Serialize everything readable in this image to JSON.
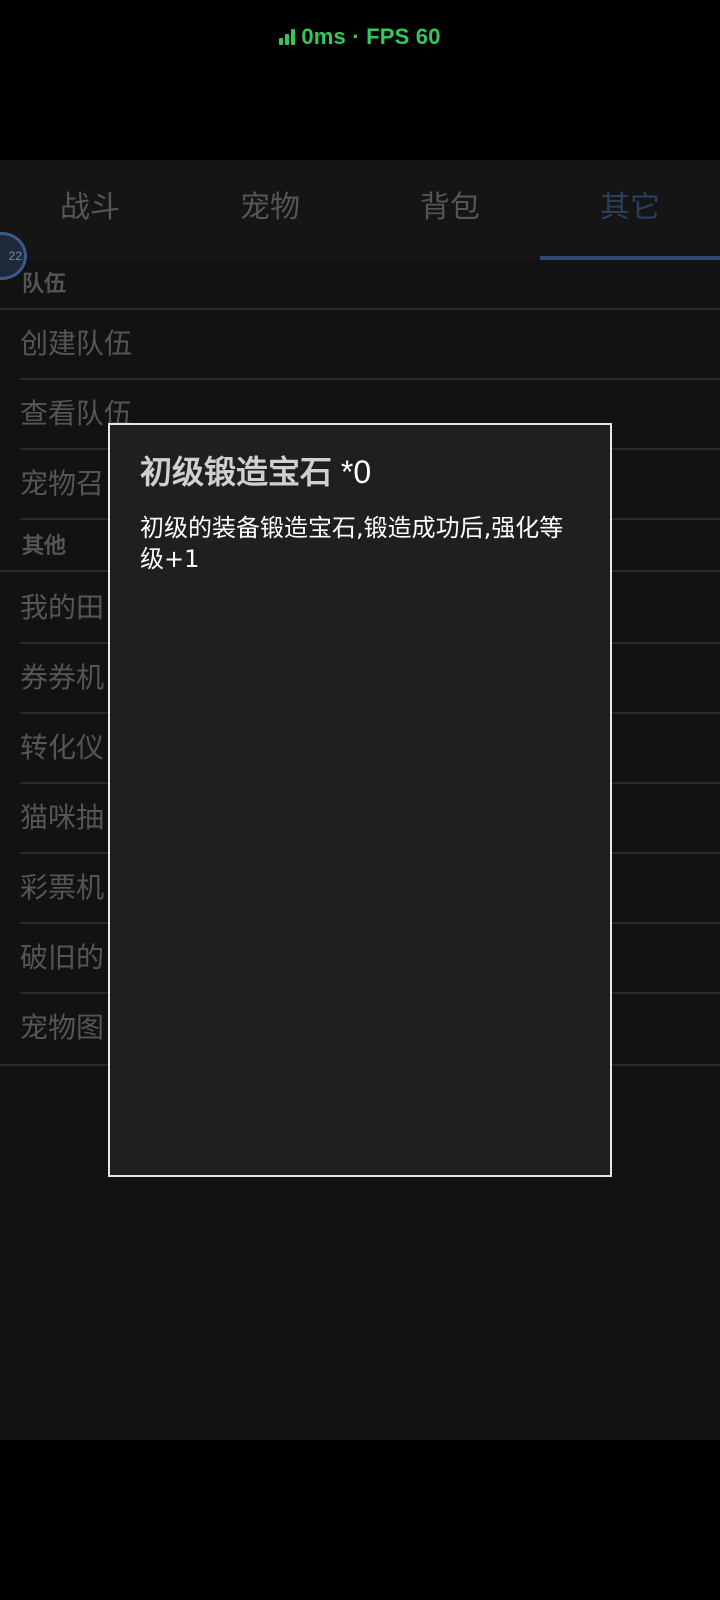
{
  "status": {
    "text": "0ms · FPS 60"
  },
  "tabs": [
    {
      "label": "战斗"
    },
    {
      "label": "宠物"
    },
    {
      "label": "背包"
    },
    {
      "label": "其它"
    }
  ],
  "avatar": {
    "text": "22"
  },
  "sections": [
    {
      "header": "队伍",
      "items": [
        "创建队伍",
        "查看队伍",
        "宠物召"
      ]
    },
    {
      "header": "其他",
      "items": [
        "我的田",
        "券券机",
        "转化仪",
        "猫咪抽",
        "彩票机",
        "破旧的",
        "宠物图"
      ]
    }
  ],
  "dialog": {
    "item_name": "初级锻造宝石",
    "count": " *0",
    "description": "初级的装备锻造宝石,锻造成功后,强化等级+1"
  },
  "colors": {
    "status_green": "#34c759",
    "active_tab_underline": "#2f4a6e",
    "dialog_border": "#e6e6e6"
  }
}
